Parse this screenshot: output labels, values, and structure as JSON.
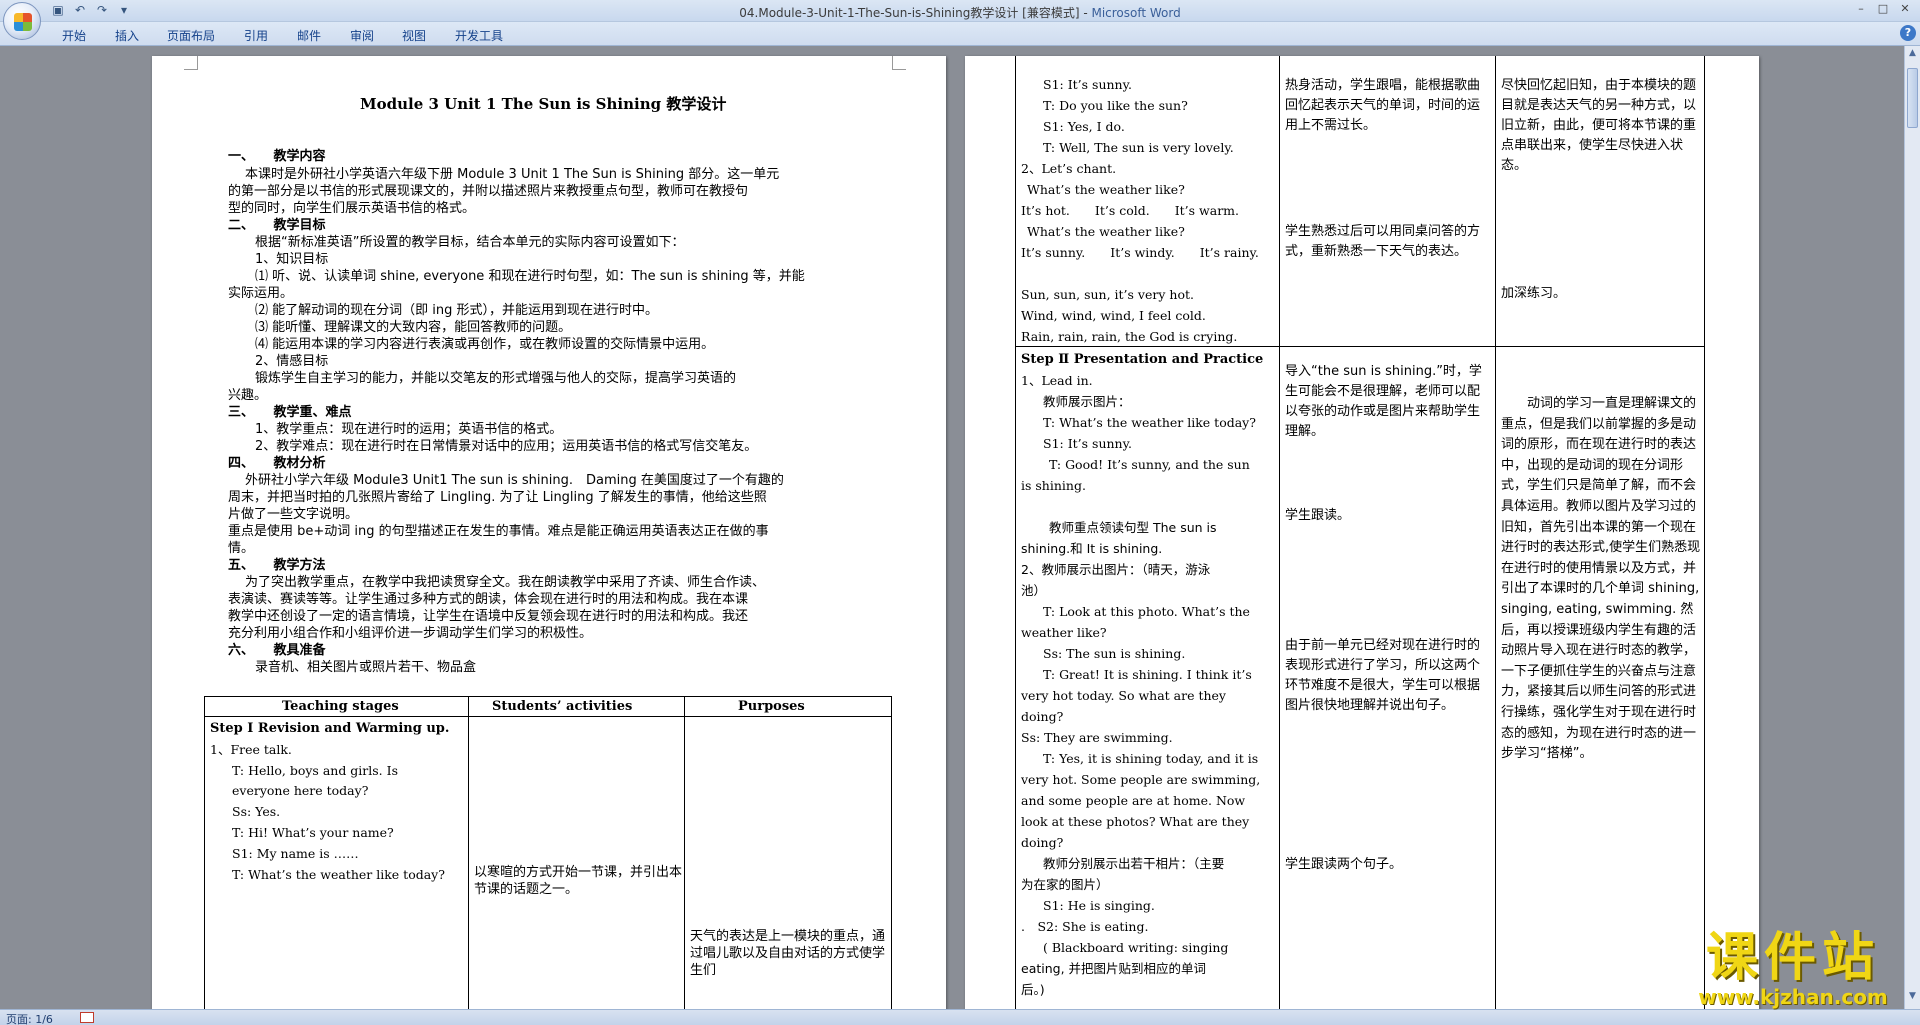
{
  "window": {
    "title": "04.Module-3-Unit-1-The-Sun-is-Shining教学设计 [兼容模式] - ",
    "app_name": "Microsoft Word"
  },
  "ribbon_tabs": [
    "开始",
    "插入",
    "页面布局",
    "引用",
    "邮件",
    "审阅",
    "视图",
    "开发工具"
  ],
  "status": {
    "page": "页面: 1/6"
  },
  "watermark": {
    "text": "课件站",
    "url": "www.kjzhan.com"
  },
  "page1": {
    "title": "Module 3 Unit 1 The Sun is Shining 教学设计",
    "lines": [
      "一、　　教学内容",
      "　本课时是外研社小学英语六年级下册 Module 3 Unit 1 The Sun is Shining 部分。这一单元",
      "的第一部分是以书信的形式展现课文的，并附以描述照片来教授重点句型，教师可在教授句",
      "型的同时，向学生们展示英语书信的格式。",
      "二、　　教学目标",
      "根据“新标准英语”所设置的教学目标，结合本单元的实际内容可设置如下：",
      "1、知识目标",
      "⑴ 听、说、认读单词 shine, everyone 和现在进行时句型，如：The sun is shining 等，并能",
      "实际运用。",
      "⑵ 能了解动词的现在分词（即 ing 形式），并能运用到现在进行时中。",
      "⑶ 能听懂、理解课文的大致内容，能回答教师的问题。",
      "⑷ 能运用本课的学习内容进行表演或再创作，或在教师设置的交际情景中运用。",
      "2、情感目标",
      "锻炼学生自主学习的能力，并能以交笔友的形式增强与他人的交际，提高学习英语的",
      "兴趣。",
      "三、　　教学重、难点",
      "1、教学重点：现在进行时的运用；英语书信的格式。",
      "2、教学难点：现在进行时在日常情景对话中的应用；运用英语书信的格式写信交笔友。",
      "四、　　教材分析",
      "　外研社小学六年级 Module3 Unit1 The sun is shining.　Daming 在美国度过了一个有趣的",
      "周末，并把当时拍的几张照片寄给了 Lingling. 为了让 Lingling 了解发生的事情，他给这些照",
      "片做了一些文字说明。",
      "重点是使用 be+动词 ing 的句型描述正在发生的事情。难点是能正确运用英语表达正在做的事",
      "情。",
      "五、　　教学方法",
      "　为了突出教学重点，在教学中我把读贯穿全文。我在朗读教学中采用了齐读、师生合作读、",
      "表演读、赛读等等。让学生通过多种方式的朗读，体会现在进行时的用法和构成。我在本课",
      "教学中还创设了一定的语言情境，让学生在语境中反复领会现在进行时的用法和构成。我还",
      "充分利用小组合作和小组评价进一步调动学生们学习的积极性。",
      "六、　　教具准备",
      "录音机、相关图片或照片若干、物品盒"
    ],
    "table": {
      "headers": [
        "Teaching stages",
        "Students’ activities",
        "Purposes"
      ],
      "stage1_title": "Step Ⅰ Revision and Warming up.",
      "col1_lines": [
        "1、Free talk.",
        "T: Hello, boys and girls. Is",
        "everyone here today?",
        "Ss: Yes.",
        "T: Hi! What’s your name?",
        "S1: My name is ……",
        "T: What’s the weather like today?"
      ],
      "col2_text": "以寒暄的方式开始一节课，并引出本节课的话题之一。",
      "col3_text": "天气的表达是上一模块的重点，通过唱儿歌以及自由对话的方式使学生们"
    }
  },
  "page2": {
    "row1": {
      "col1_lines": [
        "S1: It’s sunny.",
        "T: Do you like the sun?",
        "S1: Yes, I do.",
        "T: Well, The sun is very lovely.",
        "2、Let’s chant.",
        "What’s the weather like?",
        "It’s hot.　　It’s cold.　　It’s warm.",
        "What’s the weather like?",
        "It’s sunny.　　It’s windy.　　It’s rainy.",
        "",
        "Sun, sun, sun, it’s very hot.",
        "Wind, wind, wind, I feel cold.",
        "Rain, rain, rain, the God is crying."
      ],
      "col2_a": "热身活动，学生跟唱，能根据歌曲回忆起表示天气的单词，时间的运用上不需过长。",
      "col2_b": "学生熟悉过后可以用同桌问答的方式，重新熟悉一下天气的表达。",
      "col3_a": "尽快回忆起旧知，由于本模块的题目就是表达天气的另一种方式，以旧立新，由此，便可将本节课的重点串联出来，使学生尽快进入状态。",
      "col3_b": "加深练习。"
    },
    "row2": {
      "title": "Step Ⅱ Presentation and Practice",
      "col1_lines": [
        "1、Lead in.",
        "教师展示图片：",
        "T: What’s the weather like today?",
        "S1: It’s sunny.",
        "T: Good! It’s sunny, and the sun",
        "is shining.",
        "",
        "教师重点领读句型 The sun is",
        "shining.和 It is shining.",
        "2、教师展示出图片：（晴天，游泳",
        "池）",
        "T: Look at this photo. What’s the",
        "weather like?",
        "Ss: The sun is shining.",
        "T: Great! It is shining. I think it’s",
        "very hot today. So what are they",
        "doing?",
        "Ss: They are swimming.",
        "T: Yes, it is shining today, and it is",
        "very hot. Some people are swimming,",
        "and some people are at home. Now",
        "look at these photos? What are they",
        "doing?",
        "教师分别展示出若干相片：（主要",
        "为在家的图片）",
        "S1: He is singing.",
        ".　S2: She is eating.",
        "( Blackboard writing: singing",
        "eating, 并把图片贴到相应的单词",
        "后。)"
      ],
      "col2_a": "导入“the sun is shining.”时，学生可能会不是很理解，老师可以配以夸张的动作或是图片来帮助学生理解。",
      "col2_b": "学生跟读。",
      "col2_c": "由于前一单元已经对现在进行时的表现形式进行了学习，所以这两个环节难度不是很大，学生可以根据图片很快地理解并说出句子。",
      "col2_d": "学生跟读两个句子。",
      "col3_a": "动词的学习一直是理解课文的重点，但是我们以前掌握的多是动词的原形，而在现在进行时的表达中，出现的是动词的现在分词形式，学生们只是简单了解，而不会具体运用。教师以图片及学习过的旧知，首先引出本课的第一个现在进行时的表达形式,使学生们熟悉现在进行时的使用情景以及方式，并引出了本课时的几个单词 shining, singing, eating, swimming. 然后，再以授课班级内学生有趣的活动照片导入现在进行时态的教学，一下子便抓住学生的兴奋点与注意力，紧接其后以师生问答的形式进行操练，强化学生对于现在进行时态的感知，为现在进行时态的进一步学习“搭梯”。"
    }
  }
}
